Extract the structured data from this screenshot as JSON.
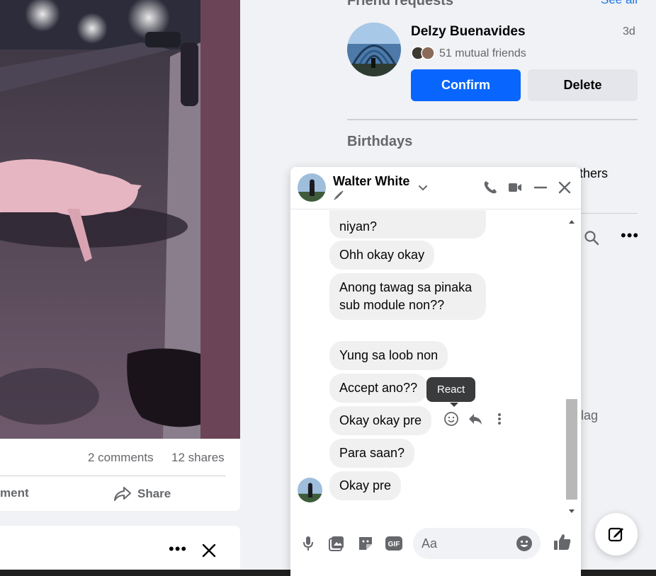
{
  "post": {
    "comments": "2 comments",
    "shares": "12 shares",
    "comment_label": "ment",
    "share_label": "Share"
  },
  "right": {
    "friend_requests_title": "Friend requests",
    "see_all": "See all",
    "request": {
      "name": "Delzy Buenavides",
      "time": "3d",
      "mutual": "51 mutual friends",
      "confirm": "Confirm",
      "delete": "Delete"
    },
    "birthdays_title": "Birthdays",
    "others_text": "thers",
    "lag_text": "lag"
  },
  "chat": {
    "name": "Walter White",
    "messages": [
      {
        "text": "niyan?"
      },
      {
        "text": "Ohh okay okay"
      },
      {
        "text": "Anong tawag sa pinaka sub module non??"
      },
      {
        "text": "Yung sa loob non"
      },
      {
        "text": "Accept ano??"
      },
      {
        "text": "Okay okay pre"
      },
      {
        "text": "Para saan?"
      },
      {
        "text": "Okay pre"
      }
    ],
    "tooltip": "React",
    "input_placeholder": "Aa"
  },
  "colors": {
    "accent": "#0866ff",
    "bubble": "#f0f0f0",
    "background": "#f0f2f5"
  }
}
